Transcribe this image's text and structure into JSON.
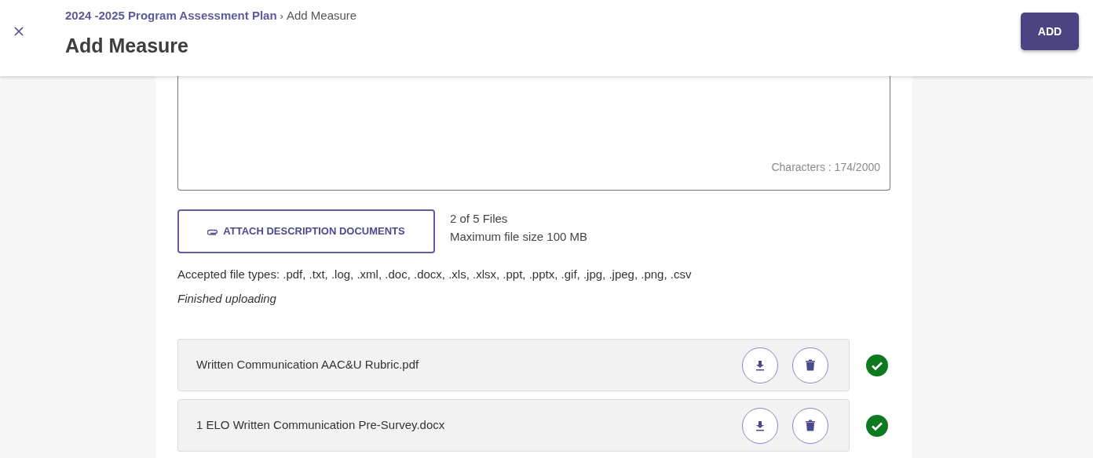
{
  "header": {
    "breadcrumb": [
      {
        "label": "2024 -2025 Program Assessment Plan",
        "kind": "link"
      },
      {
        "label": "Add Measure",
        "kind": "current"
      }
    ],
    "separator": "›",
    "title": "Add Measure",
    "add_button": "ADD"
  },
  "description": {
    "character_count": "Characters : 174/2000"
  },
  "attach": {
    "button": "ATTACH DESCRIPTION DOCUMENTS",
    "file_count": "2 of 5 Files",
    "max_size": "Maximum file size 100 MB",
    "accepted_types": "Accepted file types: .pdf, .txt, .log, .xml, .doc, .docx, .xls, .xlsx, .ppt, .pptx, .gif, .jpg, .jpeg, .png, .csv",
    "status": "Finished uploading"
  },
  "files": [
    {
      "name": "Written Communication AAC&U Rubric.pdf",
      "uploaded": true
    },
    {
      "name": "1 ELO Written Communication Pre-Survey.docx",
      "uploaded": true
    }
  ]
}
